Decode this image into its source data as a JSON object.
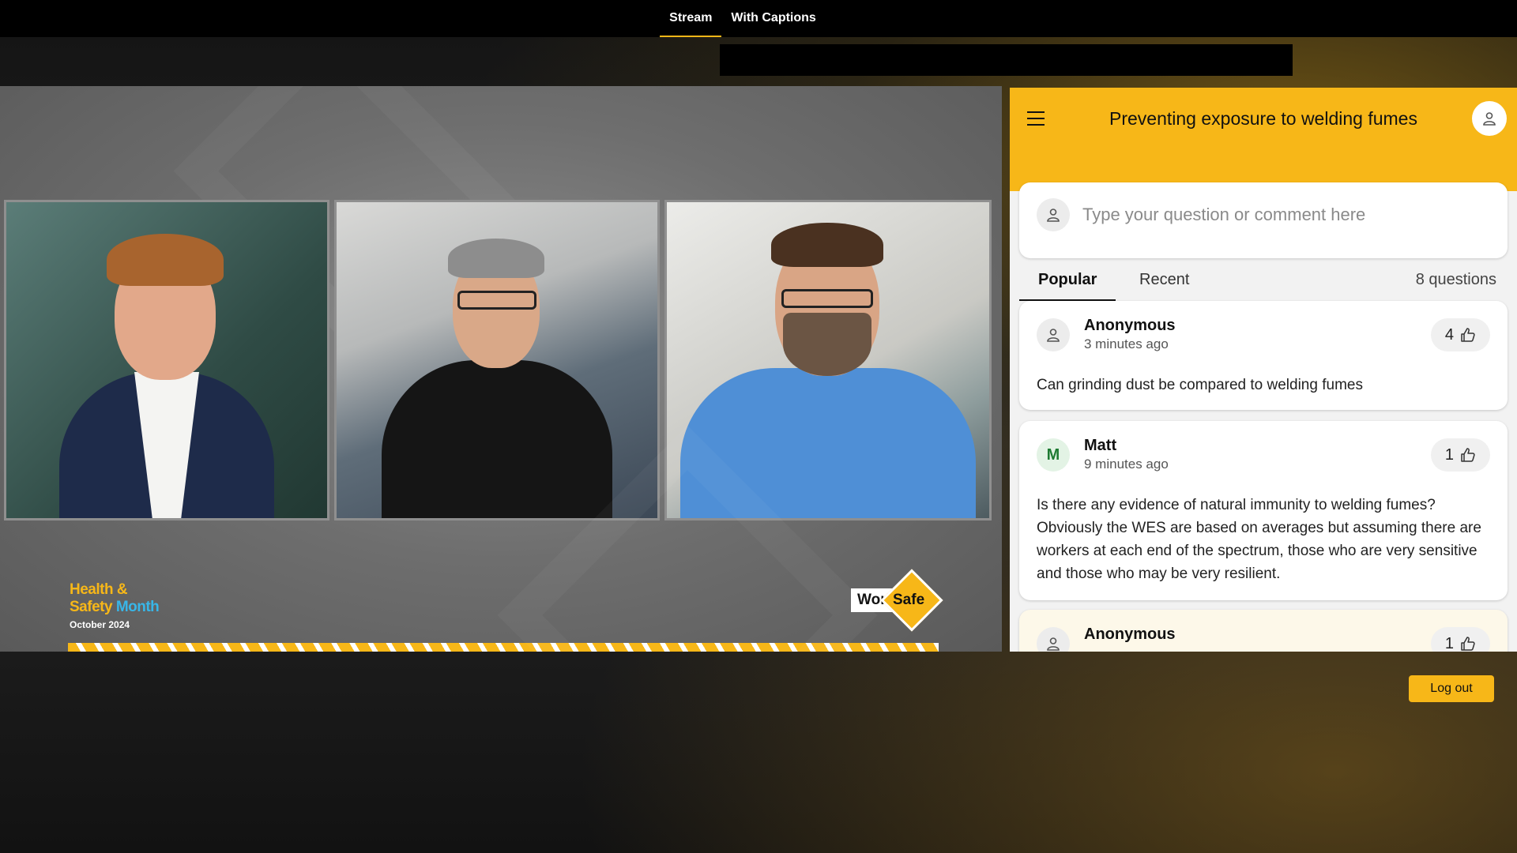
{
  "nav": {
    "tabs": [
      "Stream",
      "With Captions"
    ],
    "active": "Stream"
  },
  "video": {
    "branding": {
      "hsm_line1": "Health",
      "hsm_amp": "&",
      "hsm_line2a": "Safety",
      "hsm_line2b": "Month",
      "hsm_line3": "October 2024",
      "ws_work": "Work",
      "ws_safe": "Safe"
    }
  },
  "qa": {
    "title": "Preventing exposure to welding fumes",
    "input_placeholder": "Type your question or comment here",
    "tabs": {
      "popular": "Popular",
      "recent": "Recent"
    },
    "question_count": "8 questions",
    "questions": [
      {
        "author": "Anonymous",
        "time": "3 minutes ago",
        "likes": "4",
        "text": "Can grinding dust be compared to welding fumes",
        "avatar": "user-icon"
      },
      {
        "author": "Matt",
        "avatar_letter": "M",
        "time": "9 minutes ago",
        "likes": "1",
        "text": "Is there any evidence of natural immunity to welding fumes? Obviously the WES are based on averages but assuming there are workers at each end of the spectrum, those who are very sensitive and those who may be very resilient."
      },
      {
        "author": "Anonymous",
        "time": "",
        "likes": "1",
        "text": "",
        "avatar": "user-icon"
      }
    ]
  },
  "logout_label": "Log out",
  "colors": {
    "accent": "#f7b718",
    "stripe_accent": "#38b6e8",
    "matt_avatar_bg": "#e3f3e5",
    "matt_avatar_text": "#1e7a32"
  }
}
